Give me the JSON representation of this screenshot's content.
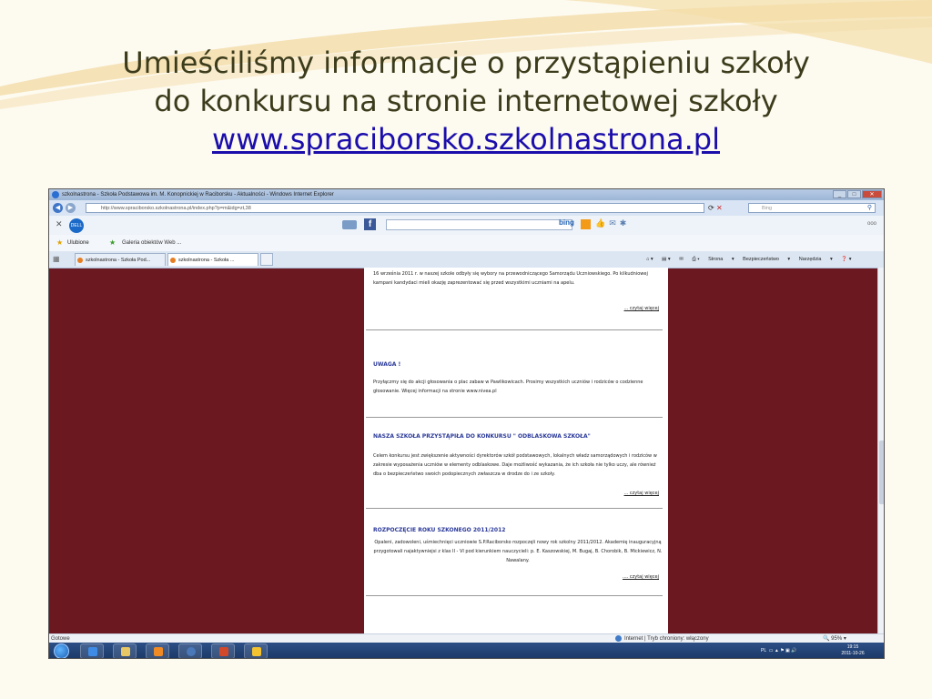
{
  "slide": {
    "title_line1": "Umieściliśmy informacje o przystąpieniu szkoły",
    "title_line2": "do konkursu na stronie internetowej szkoły",
    "title_link": "www.spraciborsko.szkolnastrona.pl"
  },
  "browser": {
    "window_title": "szkolnastrona - Szkoła Podstawowa im. M. Konopnickiej w Raciborsku - Aktualności - Windows Internet Explorer",
    "address": "http://www.spraciborsko.szkolnastrona.pl/index.php?p=m&idg=zt,38",
    "search_placeholder": "Bing",
    "favorites_label": "Ulubione",
    "gallery_label": "Galeria obiektów Web ...",
    "tabs": [
      {
        "label": "szkolnastrona - Szkoła Pod..."
      },
      {
        "label": "szkolnastrona - Szkoła ..."
      }
    ],
    "command_bar": {
      "page": "Strona",
      "security": "Bezpieczeństwo",
      "tools": "Narzędzia"
    },
    "toolbar_search_brand": "bing",
    "status": {
      "left": "Gotowe",
      "zone": "Internet | Tryb chroniony: włączony",
      "zoom": "95%"
    }
  },
  "page": {
    "items": [
      {
        "text": "16 września 2011 r. w naszej szkole odbyły się wybory na przewodniczącego Samorządu Uczniowskiego. Po kilkudniowej kampani kandydaci mieli okazję zaprezentować się przed wszystkimi uczniami na apelu.",
        "more": "... czytaj więcej"
      },
      {
        "heading": "UWAGA !",
        "text": "Przyłączmy się do akcji głosowania o plac zabaw w Pawlikowicach. Prosimy wszystkich uczniów i rodziców o codzienne głosowanie. Więcej informacji na stronie www.nivea.pl"
      },
      {
        "heading": "NASZA SZKOŁA PRZYSTĄPIŁA DO KONKURSU \" ODBLASKOWA SZKOŁA\"",
        "text": "Celem konkursu jest zwiększenie aktywności dyrektorów szkół podstawowych, lokalnych władz samorządowych i rodziców w zakresie wyposażenia uczniów w elementy odblaskowe. Daje możliwość wykazania, że ich szkoła nie tylko uczy, ale również dba o bezpieczeństwo swoich podopiecznych zwłaszcza w drodze do i ze szkoły.",
        "more": "... czytaj więcej"
      },
      {
        "heading": "ROZPOCZĘCIE ROKU SZKONEGO 2011/2012",
        "text": "Opaleni, zadowoleni, uśmiechnięci uczniowie S.P.Raciborsko rozpoczęli nowy rok szkolny 2011/2012. Akademię inauguracyjną przygotowali najaktywniejsi z klas II - VI pod kierunkiem nauczycieli: p. E. Kaszowskiej, M. Bugaj, B. Chorobik, B. Mickiewicz, N. Nawalany.",
        "more": ".... czytaj więcej"
      }
    ]
  },
  "taskbar": {
    "lang": "PL",
    "time": "19:15",
    "date": "2011-10-26"
  },
  "colors": {
    "page_background": "#6b1820",
    "heading_blue": "#2b3a9a",
    "link_blue": "#1a0dab",
    "title_text": "#3c3c1c"
  }
}
